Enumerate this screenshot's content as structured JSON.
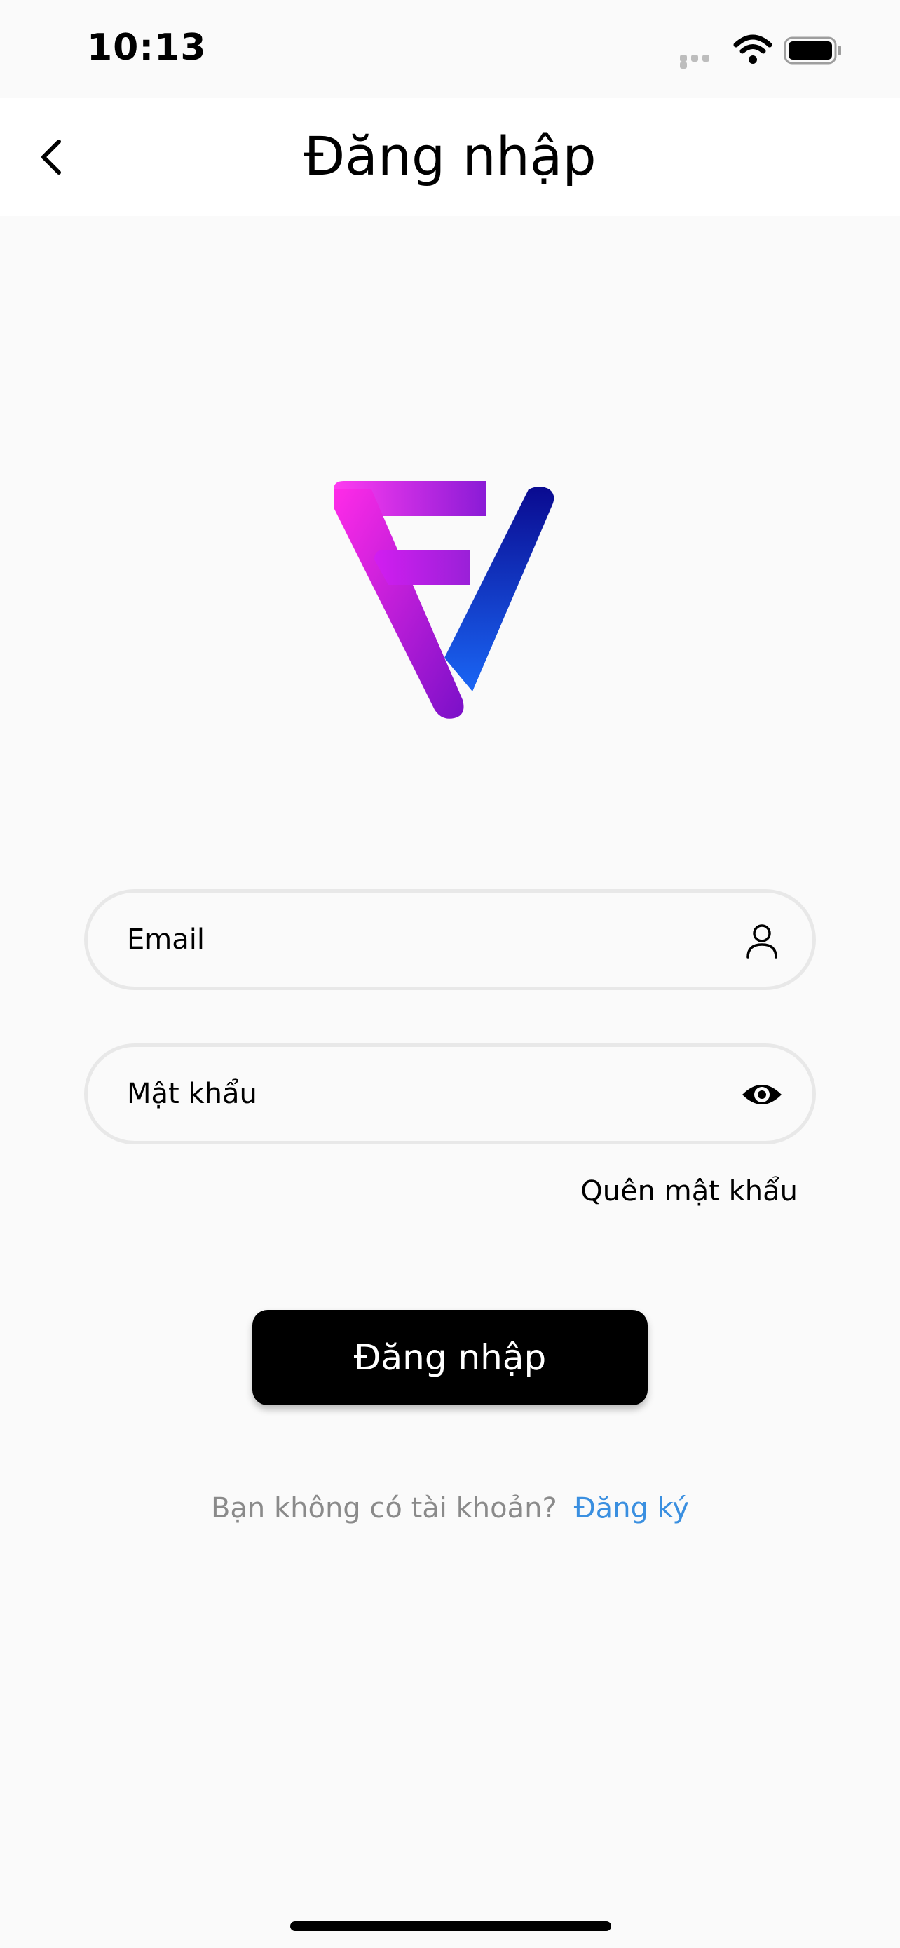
{
  "status_bar": {
    "time": "10:13",
    "icons": [
      "signal-icon",
      "wifi-icon",
      "battery-icon"
    ]
  },
  "header": {
    "title": "Đăng nhập",
    "back_icon": "chevron-left-icon"
  },
  "logo": {
    "icon": "brand-logo",
    "colors": {
      "magenta": "#ff2be0",
      "purple": "#7b1fd9",
      "navy": "#0a0aa0",
      "blue": "#1a5ef0"
    }
  },
  "form": {
    "email": {
      "placeholder": "Email",
      "value": "",
      "icon": "user-icon"
    },
    "password": {
      "placeholder": "Mật khẩu",
      "value": "",
      "icon": "eye-icon"
    },
    "forgot_password": "Quên mật khẩu",
    "submit_label": "Đăng nhập"
  },
  "signup": {
    "prompt": "Bạn không có tài khoản?",
    "link": "Đăng ký",
    "link_color": "#3a8fe0"
  }
}
